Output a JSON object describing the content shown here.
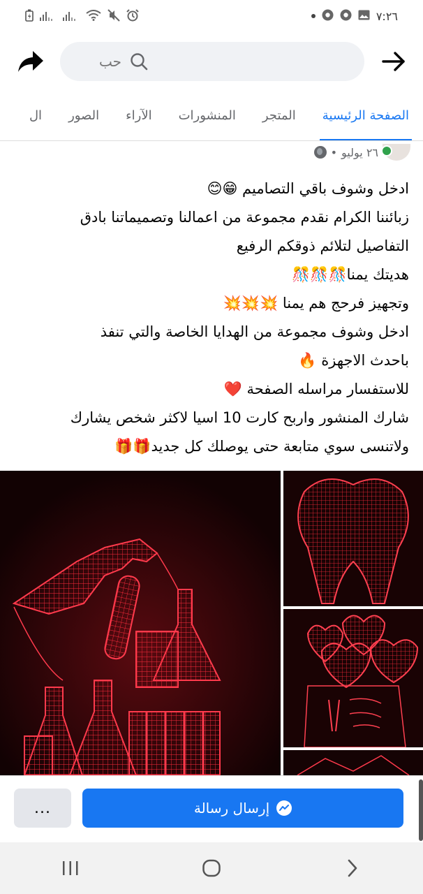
{
  "status_bar": {
    "time": "٧:٢٦",
    "icons_left": [
      "battery-icon",
      "signal-icon",
      "signal-icon",
      "wifi-icon",
      "mute-icon",
      "alarm-icon"
    ],
    "icons_right": [
      "image-icon",
      "chrome-icon",
      "chrome-icon",
      "notification-dot"
    ]
  },
  "search": {
    "placeholder": "حب"
  },
  "tabs": [
    {
      "label": "الصفحة الرئيسية",
      "active": true
    },
    {
      "label": "المتجر",
      "active": false
    },
    {
      "label": "المنشورات",
      "active": false
    },
    {
      "label": "الآراء",
      "active": false
    },
    {
      "label": "الصور",
      "active": false
    },
    {
      "label": "ال",
      "active": false
    }
  ],
  "post": {
    "date": "٢٦ يوليو",
    "separator": "•",
    "lines": [
      "ادخل وشوف باقي التصاميم 😁😊",
      "زبائننا الكرام نقدم مجموعة من اعمالنا وتصميماتنا بادق",
      "التفاصيل لتلائم ذوقكم الرفيع",
      "هديتك يمنا🎊🎊🎊",
      "وتجهيز فرحج هم يمنا 💥💥💥",
      "ادخل وشوف مجموعة من الهدايا الخاصة والتي تنفذ",
      "باحدث الاجهزة 🔥",
      "للاستفسار مراسله الصفحة ❤️",
      "شارك المنشور واربح كارت 10 اسيا لاكثر شخص يشارك",
      "ولاتنسى سوي متابعة حتى يوصلك كل جديد🎁🎁"
    ]
  },
  "photos": [
    {
      "name": "photo-lab-lamp",
      "subject": "3D lamp: hand with test tube and flasks"
    },
    {
      "name": "photo-tooth-lamp",
      "subject": "3D lamp: tooth"
    },
    {
      "name": "photo-hearts-lamp",
      "subject": "3D lamp: hearts"
    },
    {
      "name": "photo-partial",
      "subject": "partially visible photo"
    }
  ],
  "actions": {
    "message_label": "إرسال رسالة",
    "more_label": "..."
  },
  "colors": {
    "accent": "#1877f2",
    "neon": "#ff2a3c",
    "photo_bg": "#140304"
  }
}
